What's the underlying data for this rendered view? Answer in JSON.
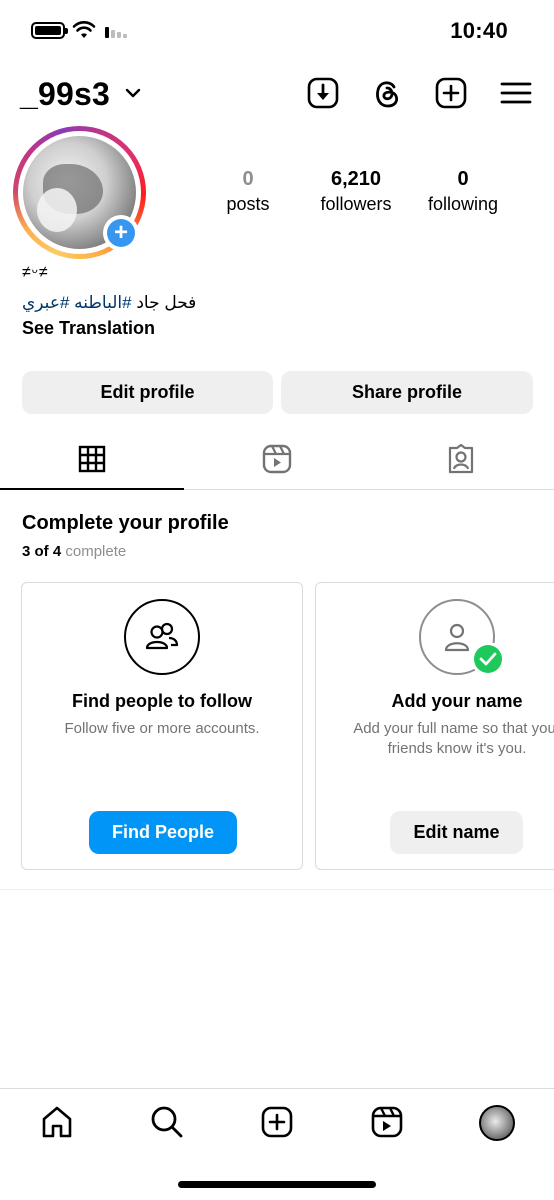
{
  "status_bar": {
    "time": "10:40"
  },
  "header": {
    "username": "_99s3"
  },
  "profile": {
    "stats": {
      "posts_value": "0",
      "posts_label": "posts",
      "followers_value": "6,210",
      "followers_label": "followers",
      "following_value": "0",
      "following_label": "following"
    },
    "bio": {
      "emoji_line": "≠ᵕ≠",
      "text_plain": "فحل جاد",
      "hashtag_1": "#الباطنه",
      "hashtag_2": "#عبري",
      "see_translation": "See Translation"
    },
    "buttons": {
      "edit": "Edit profile",
      "share": "Share profile"
    }
  },
  "complete_profile": {
    "title": "Complete your profile",
    "progress_count": "3 of 4",
    "progress_suffix": "complete",
    "cards": [
      {
        "title": "Find people to follow",
        "desc_line1": "Follow five or more accounts.",
        "desc_line2": "",
        "button": "Find People"
      },
      {
        "title": "Add your name",
        "desc_line1": "Add your full name so that your",
        "desc_line2": "friends know it's you.",
        "button": "Edit name"
      }
    ]
  },
  "colors": {
    "accent_blue": "#0095f6",
    "link_blue": "#00376b",
    "check_green": "#1ec95c"
  }
}
